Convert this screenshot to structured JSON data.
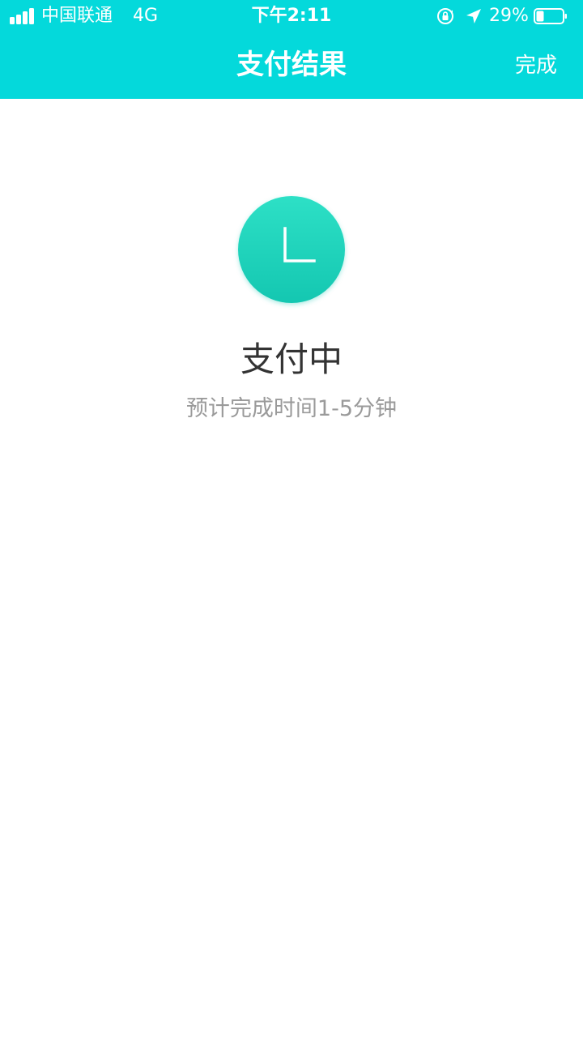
{
  "status_bar": {
    "carrier": "中国联通",
    "network": "4G",
    "time": "下午2:11",
    "battery_percent": "29%",
    "battery_level": 0.29,
    "icons": [
      "signal-icon",
      "rotation-lock-icon",
      "location-arrow-icon",
      "battery-icon"
    ]
  },
  "nav": {
    "title": "支付结果",
    "done_label": "完成"
  },
  "result": {
    "icon": "clock-icon",
    "title": "支付中",
    "subtitle": "预计完成时间1-5分钟"
  },
  "colors": {
    "header_bg": "#04d9db",
    "accent": "#1ecfb8",
    "title_text": "#333333",
    "subtitle_text": "#9a9a9a"
  }
}
